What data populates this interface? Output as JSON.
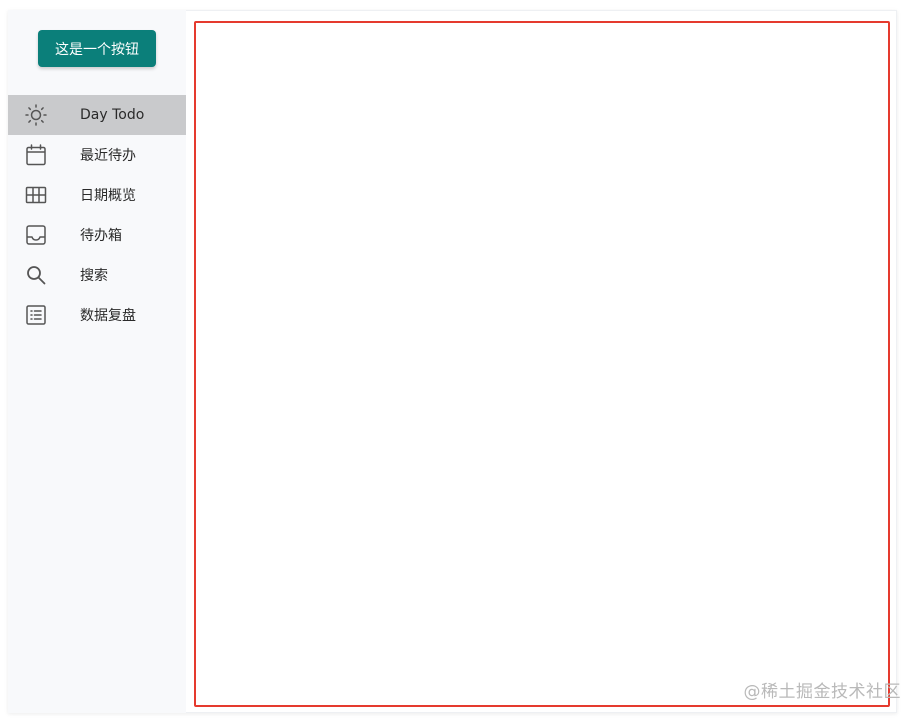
{
  "sidebar": {
    "button_label": "这是一个按钮",
    "items": [
      {
        "label": "Day Todo",
        "icon": "sun-icon",
        "active": true
      },
      {
        "label": "最近待办",
        "icon": "calendar-icon",
        "active": false
      },
      {
        "label": "日期概览",
        "icon": "grid-icon",
        "active": false
      },
      {
        "label": "待办箱",
        "icon": "inbox-icon",
        "active": false
      },
      {
        "label": "搜索",
        "icon": "search-icon",
        "active": false
      },
      {
        "label": "数据复盘",
        "icon": "list-icon",
        "active": false
      }
    ]
  },
  "watermark": "@稀土掘金技术社区",
  "colors": {
    "accent": "#0b7f7a",
    "active_bg": "#c9cacc",
    "highlight_border": "#e53a2e",
    "sidebar_bg": "#f8f9fb"
  }
}
